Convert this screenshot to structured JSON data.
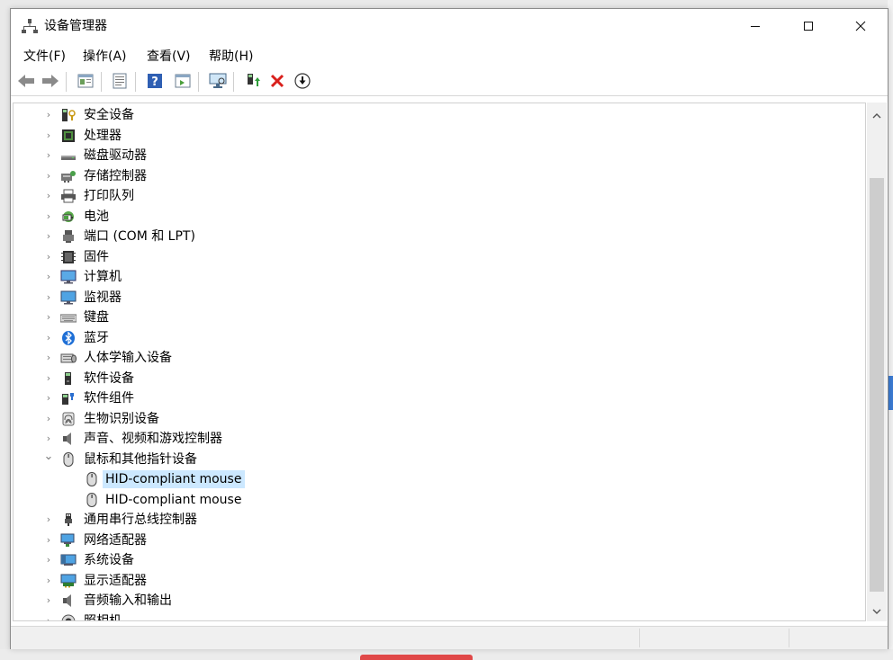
{
  "window": {
    "title": "设备管理器"
  },
  "menu": [
    "文件(F)",
    "操作(A)",
    "查看(V)",
    "帮助(H)"
  ],
  "toolbar": [
    "back-icon",
    "forward-icon",
    "properties-icon",
    "details-icon",
    "help-icon",
    "show-hidden-icon",
    "scan-hardware-icon",
    "update-driver-icon",
    "uninstall-icon",
    "enable-icon"
  ],
  "tree": [
    {
      "label": "安全设备",
      "icon": "security-device-icon",
      "expanded": false
    },
    {
      "label": "处理器",
      "icon": "processor-icon",
      "expanded": false
    },
    {
      "label": "磁盘驱动器",
      "icon": "disk-drive-icon",
      "expanded": false
    },
    {
      "label": "存储控制器",
      "icon": "storage-controller-icon",
      "expanded": false
    },
    {
      "label": "打印队列",
      "icon": "print-queue-icon",
      "expanded": false
    },
    {
      "label": "电池",
      "icon": "battery-icon",
      "expanded": false
    },
    {
      "label": "端口 (COM 和 LPT)",
      "icon": "port-icon",
      "expanded": false
    },
    {
      "label": "固件",
      "icon": "firmware-icon",
      "expanded": false
    },
    {
      "label": "计算机",
      "icon": "computer-icon",
      "expanded": false
    },
    {
      "label": "监视器",
      "icon": "monitor-icon",
      "expanded": false
    },
    {
      "label": "键盘",
      "icon": "keyboard-icon",
      "expanded": false
    },
    {
      "label": "蓝牙",
      "icon": "bluetooth-icon",
      "expanded": false
    },
    {
      "label": "人体学输入设备",
      "icon": "hid-icon",
      "expanded": false
    },
    {
      "label": "软件设备",
      "icon": "software-device-icon",
      "expanded": false
    },
    {
      "label": "软件组件",
      "icon": "software-component-icon",
      "expanded": false
    },
    {
      "label": "生物识别设备",
      "icon": "biometric-icon",
      "expanded": false
    },
    {
      "label": "声音、视频和游戏控制器",
      "icon": "sound-icon",
      "expanded": false
    },
    {
      "label": "鼠标和其他指针设备",
      "icon": "mouse-icon",
      "expanded": true,
      "children": [
        {
          "label": "HID-compliant mouse",
          "icon": "mouse-icon",
          "selected": true
        },
        {
          "label": "HID-compliant mouse",
          "icon": "mouse-icon",
          "selected": false
        }
      ]
    },
    {
      "label": "通用串行总线控制器",
      "icon": "usb-icon",
      "expanded": false
    },
    {
      "label": "网络适配器",
      "icon": "network-adapter-icon",
      "expanded": false
    },
    {
      "label": "系统设备",
      "icon": "system-device-icon",
      "expanded": false
    },
    {
      "label": "显示适配器",
      "icon": "display-adapter-icon",
      "expanded": false
    },
    {
      "label": "音频输入和输出",
      "icon": "audio-io-icon",
      "expanded": false
    },
    {
      "label": "照相机",
      "icon": "camera-icon",
      "expanded": false
    }
  ]
}
